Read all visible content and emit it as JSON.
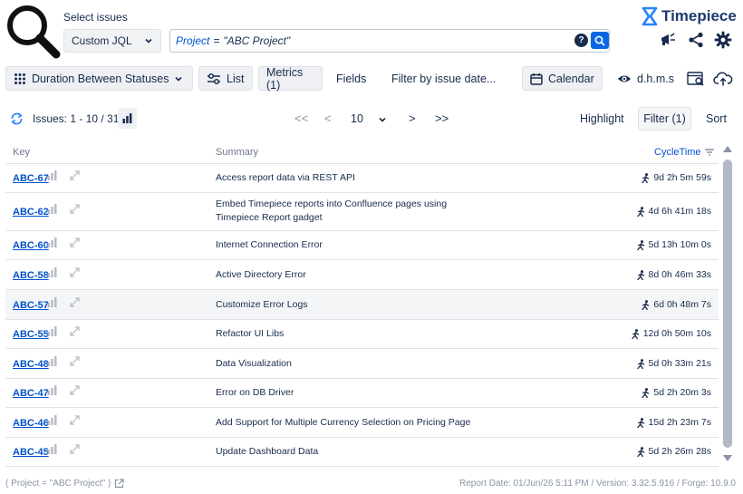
{
  "header": {
    "select_label": "Select issues",
    "jql_mode": "Custom JQL",
    "query": {
      "field": "Project",
      "operator": "=",
      "value": "\"ABC Project\""
    },
    "help_label": "?",
    "brand": "Timepiece"
  },
  "toolbar": {
    "report_type": "Duration Between Statuses",
    "list_label": "List",
    "metrics_label": "Metrics (1)",
    "fields_label": "Fields",
    "filter_date_label": "Filter by issue date...",
    "calendar_label": "Calendar",
    "format_label": "d.h.m.s"
  },
  "status": {
    "issues_label": "Issues: 1 - 10 / 31",
    "first_page": "<<",
    "prev_page": "<",
    "page_size": "10",
    "next_page": ">",
    "last_page": ">>",
    "highlight_label": "Highlight",
    "filter_label": "Filter (1)",
    "sort_label": "Sort"
  },
  "table": {
    "columns": {
      "key": "Key",
      "summary": "Summary",
      "cycle": "CycleTime"
    },
    "rows": [
      {
        "key": "ABC-67",
        "summary": "Access report data via REST API",
        "time": "9d 2h 5m 59s"
      },
      {
        "key": "ABC-62",
        "summary": "Embed Timepiece reports into Confluence pages using Timepiece Report gadget",
        "time": "4d 6h 41m 18s"
      },
      {
        "key": "ABC-60",
        "summary": "Internet Connection Error",
        "time": "5d 13h 10m 0s"
      },
      {
        "key": "ABC-58",
        "summary": "Active Directory Error",
        "time": "8d 0h 46m 33s"
      },
      {
        "key": "ABC-57",
        "summary": "Customize Error Logs",
        "time": "6d 0h 48m 7s"
      },
      {
        "key": "ABC-55",
        "summary": "Refactor UI Libs",
        "time": "12d 0h 50m 10s"
      },
      {
        "key": "ABC-48",
        "summary": "Data Visualization",
        "time": "5d 0h 33m 21s"
      },
      {
        "key": "ABC-47",
        "summary": "Error on DB Driver",
        "time": "5d 2h 20m 3s"
      },
      {
        "key": "ABC-46",
        "summary": "Add Support for Multiple Currency Selection on Pricing Page",
        "time": "15d 2h 23m 7s"
      },
      {
        "key": "ABC-45",
        "summary": "Update Dashboard Data",
        "time": "5d 2h 26m 28s"
      }
    ]
  },
  "footer": {
    "query": "( Project = \"ABC Project\" )",
    "report_info": "Report Date: 01/Jun/26 5:11 PM / Version: 3.32.5.916 / Forge: 10.9.0"
  },
  "colors": {
    "accent": "#0c66e4",
    "link": "#0052cc",
    "brand": "#1d3a6d",
    "brand_icon": "#2684ff"
  }
}
